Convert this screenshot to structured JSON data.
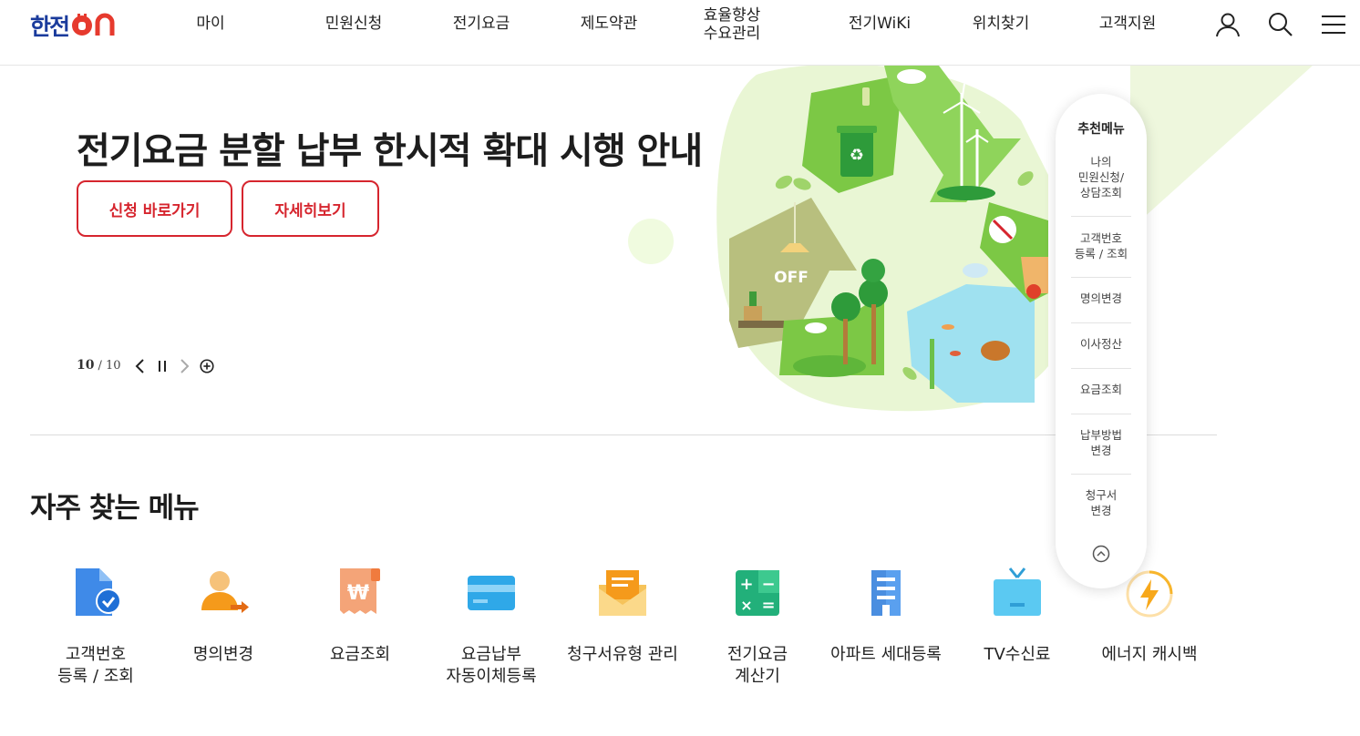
{
  "header": {
    "logo_text": "한전",
    "nav": [
      {
        "label": "마이"
      },
      {
        "label": "민원신청"
      },
      {
        "label": "전기요금"
      },
      {
        "label": "제도약관"
      },
      {
        "label": "효율향상\n수요관리"
      },
      {
        "label": "전기WiKi"
      },
      {
        "label": "위치찾기"
      },
      {
        "label": "고객지원"
      }
    ],
    "icons": [
      "user-icon",
      "search-icon",
      "menu-icon"
    ]
  },
  "hero": {
    "title": "전기요금 분할 납부 한시적 확대 시행 안내",
    "apply_button": "신청 바로가기",
    "detail_button": "자세히보기",
    "slide_current": "10",
    "slide_total": "/ 10",
    "illustration_text": "OFF"
  },
  "frequent": {
    "title": "자주 찾는 메뉴",
    "items": [
      {
        "label": "고객번호\n등록 / 조회",
        "icon": "document-check-icon"
      },
      {
        "label": "명의변경",
        "icon": "person-transfer-icon"
      },
      {
        "label": "요금조회",
        "icon": "won-receipt-icon"
      },
      {
        "label": "요금납부\n자동이체등록",
        "icon": "credit-card-icon"
      },
      {
        "label": "청구서유형 관리",
        "icon": "envelope-icon"
      },
      {
        "label": "전기요금\n계산기",
        "icon": "calculator-icon"
      },
      {
        "label": "아파트 세대등록",
        "icon": "apartment-icon"
      },
      {
        "label": "TV수신료",
        "icon": "tv-icon"
      },
      {
        "label": "에너지 캐시백",
        "icon": "lightning-icon"
      }
    ]
  },
  "recommended": {
    "title": "추천메뉴",
    "items": [
      {
        "label": "나의\n민원신청/\n상담조회"
      },
      {
        "label": "고객번호\n등록 / 조회"
      },
      {
        "label": "명의변경"
      },
      {
        "label": "이사정산"
      },
      {
        "label": "요금조회"
      },
      {
        "label": "납부방법\n변경"
      },
      {
        "label": "청구서\n변경"
      }
    ]
  },
  "colors": {
    "brand_blue": "#1a3b9c",
    "accent_red": "#d6252e",
    "eco_green": "#7cc845"
  }
}
